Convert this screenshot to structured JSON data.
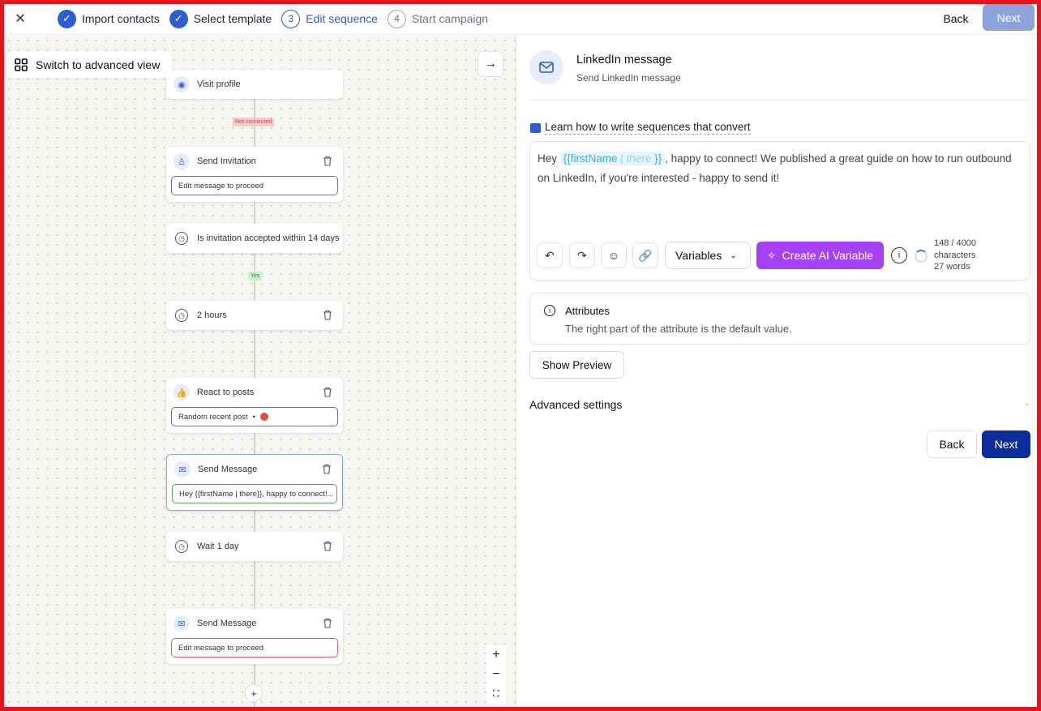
{
  "header": {
    "steps": [
      {
        "label": "Import contacts",
        "state": "done"
      },
      {
        "label": "Select template",
        "state": "done"
      },
      {
        "number": "3",
        "label": "Edit sequence",
        "state": "active"
      },
      {
        "number": "4",
        "label": "Start campaign",
        "state": "pending"
      }
    ],
    "back_label": "Back",
    "next_label": "Next"
  },
  "canvas": {
    "advanced_view_label": "Switch to advanced view",
    "nodes": [
      {
        "title": "Visit profile",
        "icon": "eye-icon"
      },
      {
        "title": "Send Invitation",
        "icon": "user-plus-icon",
        "field": "Edit message to proceed"
      },
      {
        "title": "Is invitation accepted within 14 days",
        "icon": "clock-icon"
      },
      {
        "title": "2 hours",
        "icon": "clock-icon"
      },
      {
        "title": "React to posts",
        "icon": "thumbs-up-icon",
        "field": "Random recent post"
      },
      {
        "title": "Send Message",
        "icon": "envelope-icon",
        "field": "Hey {{firstName | there}}, happy to connect!..."
      },
      {
        "title": "Wait 1 day",
        "icon": "clock-icon"
      },
      {
        "title": "Send Message",
        "icon": "envelope-icon",
        "field": "Edit message to proceed"
      }
    ],
    "tags": {
      "not_connected": "Not connected",
      "yes": "Yes"
    },
    "zoom_in": "+",
    "zoom_out": "−",
    "add_node": "+"
  },
  "panel": {
    "title": "LinkedIn message",
    "subtitle": "Send LinkedIn message",
    "learn_link": "Learn how to write sequences that convert",
    "message": {
      "prefix": "Hey ",
      "var_open": "{{firstName",
      "var_default": " | there ",
      "var_close": "}}",
      "body": ", happy to connect! We published a great guide on how to run outbound on LinkedIn, if you're interested - happy to send it!"
    },
    "variables_label": "Variables",
    "ai_variable_label": "Create AI Variable",
    "counts": {
      "chars": "148 / 4000",
      "chars_unit": "characters",
      "words": "27 words"
    },
    "attributes": {
      "title": "Attributes",
      "desc": "The right part of the attribute is the default value."
    },
    "show_preview_label": "Show Preview",
    "advanced_settings_label": "Advanced settings",
    "back_label": "Back",
    "next_label": "Next"
  },
  "colors": {
    "accent": "#2f5bd3",
    "ai_purple": "#a541f5",
    "next_dark": "#0b2d9b",
    "frame_red": "#e3141b"
  }
}
